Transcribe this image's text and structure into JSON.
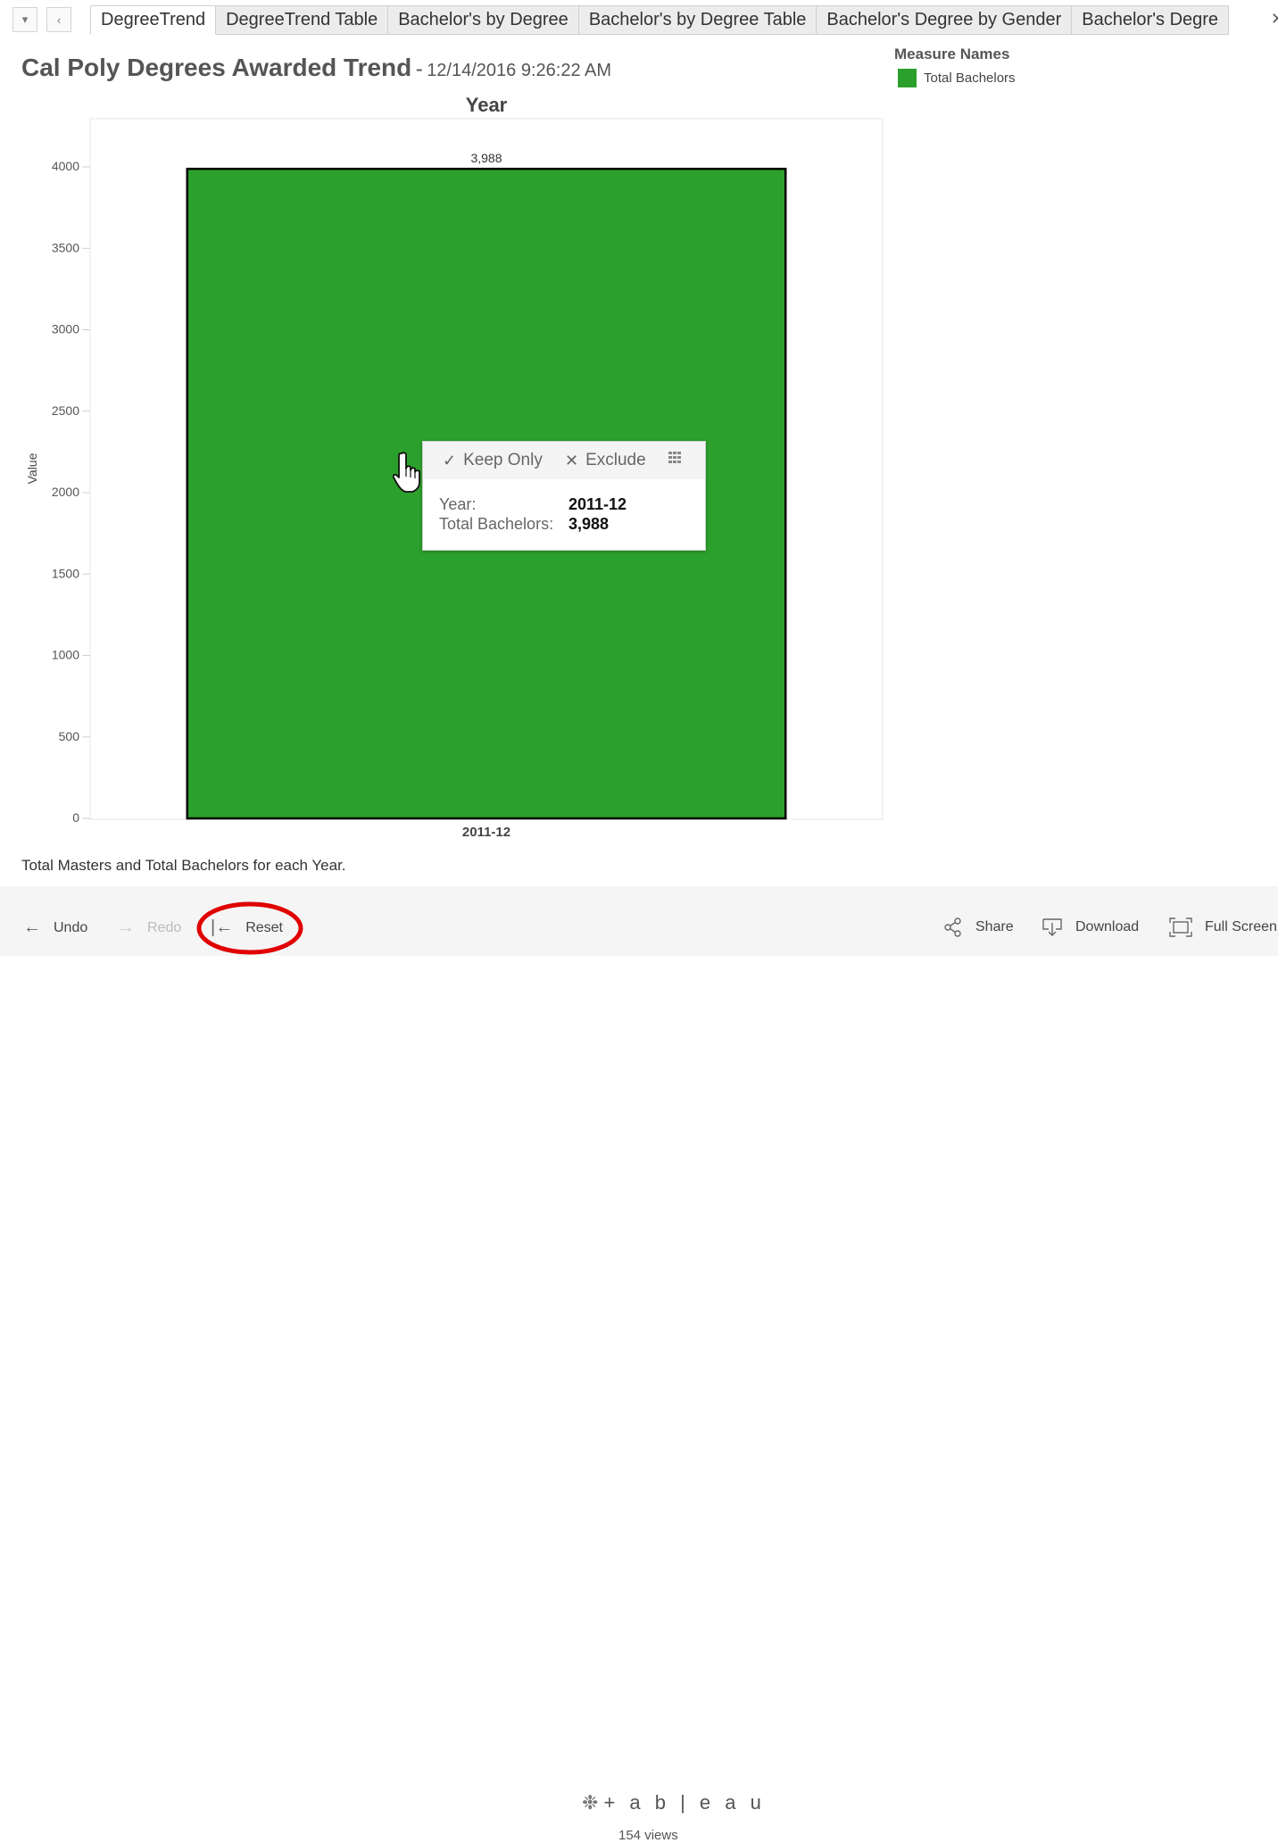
{
  "tabs": [
    {
      "label": "DegreeTrend",
      "active": true
    },
    {
      "label": "DegreeTrend Table",
      "active": false
    },
    {
      "label": "Bachelor's by Degree",
      "active": false
    },
    {
      "label": "Bachelor's by Degree Table",
      "active": false
    },
    {
      "label": "Bachelor's Degree by Gender",
      "active": false
    },
    {
      "label": "Bachelor's Degre",
      "active": false
    }
  ],
  "tab_nav": {
    "menu_icon": "dropdown-arrow-icon",
    "prev_icon": "chevron-left-icon",
    "close_icon": "close-icon"
  },
  "header": {
    "title": "Cal Poly Degrees Awarded Trend",
    "separator": "-",
    "timestamp": "12/14/2016 9:26:22 AM"
  },
  "legend": {
    "title": "Measure Names",
    "item": "Total Bachelors",
    "color": "#2ca02c"
  },
  "chart_data": {
    "type": "bar",
    "title": "Year",
    "xlabel": "",
    "ylabel": "Value",
    "categories": [
      "2011-12"
    ],
    "series": [
      {
        "name": "Total Bachelors",
        "values": [
          3988
        ],
        "color": "#2ca02c"
      }
    ],
    "value_labels": [
      "3,988"
    ],
    "ylim": [
      0,
      4000
    ],
    "yticks": [
      0,
      500,
      1000,
      1500,
      2000,
      2500,
      3000,
      3500,
      4000
    ],
    "grid": false,
    "legend_position": "top-right"
  },
  "tooltip": {
    "keep_only": "Keep Only",
    "exclude": "Exclude",
    "check_icon": "checkmark-icon",
    "x_icon": "exclude-x-icon",
    "grid_icon": "view-data-icon",
    "rows": [
      {
        "label": "Year:",
        "value": "2011-12"
      },
      {
        "label": "Total Bachelors:",
        "value": "3,988"
      }
    ]
  },
  "caption": "Total Masters and Total Bachelors for each Year.",
  "toolbar": {
    "undo": "Undo",
    "redo": "Redo",
    "reset": "Reset",
    "share": "Share",
    "download": "Download",
    "fullscreen": "Full Screen",
    "brand": "+ a b | e a u",
    "views": "154 views"
  },
  "colors": {
    "bar": "#2ca02c",
    "highlight": "#e00000"
  }
}
